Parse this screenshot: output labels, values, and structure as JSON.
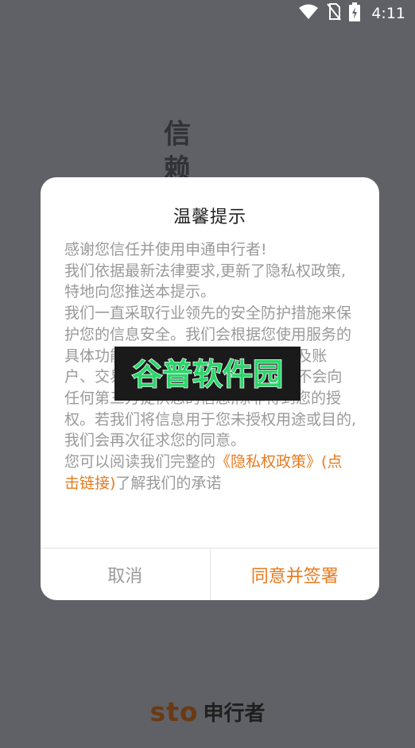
{
  "status_bar": {
    "time": "4:11",
    "icons": [
      "wifi-icon",
      "no-sim-icon",
      "battery-charging-icon"
    ]
  },
  "background": {
    "title": "信赖"
  },
  "dialog": {
    "title": "温馨提示",
    "paragraph1": "感谢您信任并使用申通申行者!",
    "paragraph2": "我们依据最新法律要求,更新了隐私权政策,特地向您推送本提示。",
    "paragraph3": "我们一直采取行业领先的安全防护措施来保护您的信息安全。我们会根据您使用服务的具体功能需要收集使用信息(可能涉及账户、交易、设备等相关信息)。我们不会向任何第三方提供您的信息,除非得到您的授权。若我们将信息用于您未授权用途或目的,我们会再次征求您的同意。",
    "paragraph4_prefix": "您可以阅读我们完整的",
    "policy_link": "《隐私权政策》(点击链接)",
    "paragraph4_suffix": "了解我们的承诺",
    "cancel_label": "取消",
    "agree_label": "同意并签署"
  },
  "watermark": {
    "text": "谷普软件园",
    "colors": {
      "primary": "#2bd66b",
      "background": "#1a1a1a"
    }
  },
  "brand": {
    "logo_text": "sto",
    "name": "申行者"
  },
  "colors": {
    "overlay": "#5f6166",
    "accent": "#e87a1e",
    "muted_text": "#9a9a9a",
    "brand_logo": "#6a3a14"
  }
}
